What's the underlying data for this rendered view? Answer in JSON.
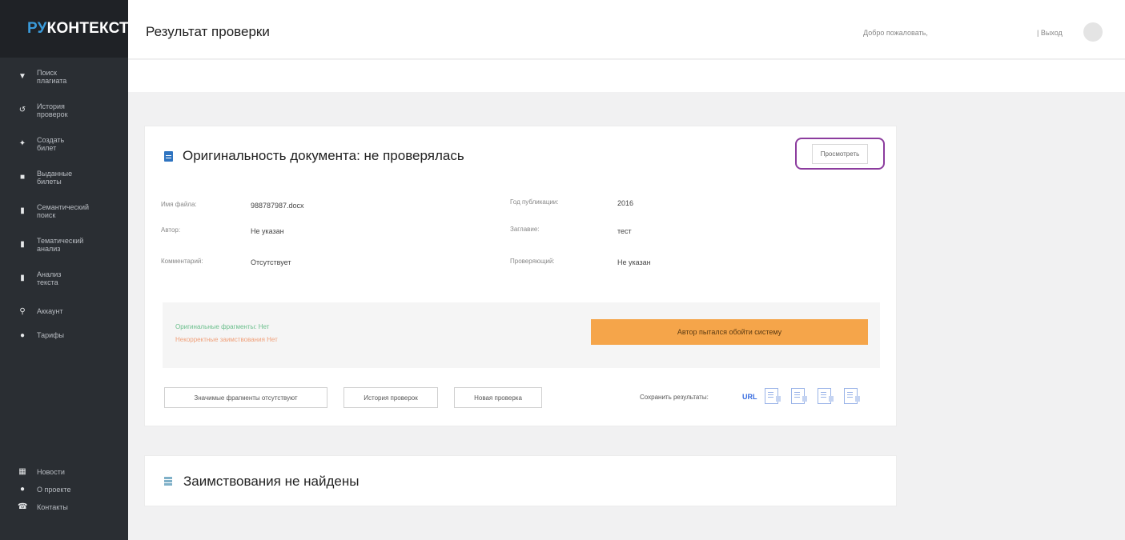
{
  "brand": {
    "ru": "РУ",
    "rest": "КОНТЕКСТ",
    "accent": "#3a9ad9"
  },
  "sidebar": {
    "items": [
      {
        "icon": "shield-icon",
        "glyph": "▼",
        "label": "Поиск\nплагиата"
      },
      {
        "icon": "history-icon",
        "glyph": "↺",
        "label": "История\nпроверок"
      },
      {
        "icon": "pin-icon",
        "glyph": "✦",
        "label": "Создать\nбилет"
      },
      {
        "icon": "folder-icon",
        "glyph": "■",
        "label": "Выданные\nбилеты"
      },
      {
        "icon": "document-icon",
        "glyph": "▮",
        "label": "Семантический\nпоиск"
      },
      {
        "icon": "document-icon",
        "glyph": "▮",
        "label": "Тематический\nанализ"
      },
      {
        "icon": "document-icon",
        "glyph": "▮",
        "label": "Анализ\nтекста"
      },
      {
        "icon": "user-icon",
        "glyph": "⚲",
        "label": "Аккаунт"
      },
      {
        "icon": "circle-icon",
        "glyph": "●",
        "label": "Тарифы"
      }
    ],
    "bottom": [
      {
        "icon": "news-icon",
        "glyph": "▦",
        "label": "Новости"
      },
      {
        "icon": "info-icon",
        "glyph": "●",
        "label": "О проекте"
      },
      {
        "icon": "phone-icon",
        "glyph": "☎",
        "label": "Контакты"
      }
    ]
  },
  "header": {
    "title": "Результат проверки",
    "welcome": "Добро пожаловать,",
    "logout": "| Выход"
  },
  "report": {
    "title": "Оригинальность документа: не проверялась",
    "view_button": "Просмотреть",
    "fields": [
      {
        "label": "Имя файла:",
        "value": "988787987.docx"
      },
      {
        "label": "Автор:",
        "value": "Не указан"
      },
      {
        "label": "Комментарий:",
        "value": "Отсутствует"
      },
      {
        "label": "Год публикации:",
        "value": "2016"
      },
      {
        "label": "Заглавие:",
        "value": "тест"
      },
      {
        "label": "Проверяющий:",
        "value": "Не указан"
      }
    ],
    "original_fragments": "Оригинальные фрагменты:    Нет",
    "incorrect_borrowings": "Некорректные заимствования Нет",
    "alert": "Автор пытался обойти систему",
    "buttons": {
      "fragments": "Значимые фрагменты отсутствуют",
      "history": "История проверок",
      "new_check": "Новая проверка"
    },
    "save_label": "Сохранить результаты:",
    "url_label": "URL"
  },
  "borrowings": {
    "title": "Заимствования не найдены"
  },
  "colors": {
    "sidebar": "#2a2e33",
    "alert": "#f5a54a",
    "highlight_border": "#8c3c9e",
    "icon_blue": "#2f74c0"
  }
}
